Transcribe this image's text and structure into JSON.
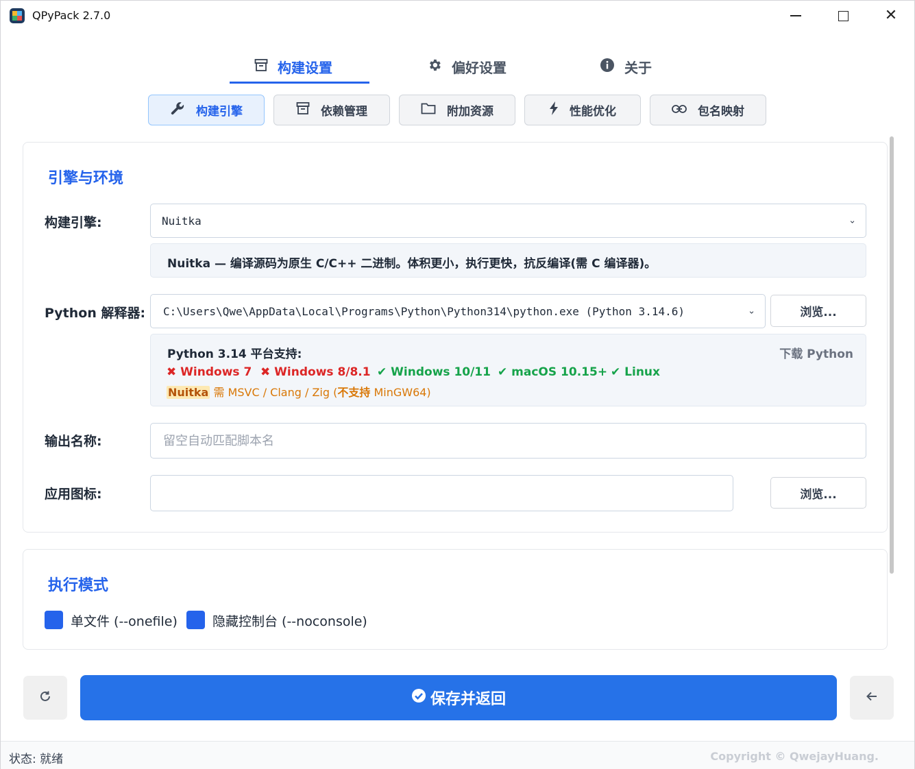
{
  "window": {
    "title": "QPyPack 2.7.0",
    "minimize_glyph": "—",
    "close_glyph": "✕"
  },
  "top_tabs": [
    {
      "label": "构建设置",
      "icon": "archive-icon",
      "active": true
    },
    {
      "label": "偏好设置",
      "icon": "gear-icon",
      "active": false
    },
    {
      "label": "关于",
      "icon": "info-icon",
      "active": false
    }
  ],
  "sub_tabs": [
    {
      "label": "构建引擎",
      "icon": "wrench-icon",
      "active": true
    },
    {
      "label": "依赖管理",
      "icon": "archive-icon",
      "active": false
    },
    {
      "label": "附加资源",
      "icon": "folder-icon",
      "active": false
    },
    {
      "label": "性能优化",
      "icon": "bolt-icon",
      "active": false
    },
    {
      "label": "包名映射",
      "icon": "link-icon",
      "active": false
    }
  ],
  "engine_section": {
    "title": "引擎与环境",
    "engine_label": "构建引擎:",
    "engine_value": "Nuitka",
    "engine_desc": "Nuitka — 编译源码为原生 C/C++ 二进制。体积更小，执行更快，抗反编译(需 C 编译器)。",
    "interpreter_label": "Python 解释器:",
    "interpreter_value": "C:\\Users\\Qwe\\AppData\\Local\\Programs\\Python\\Python314\\python.exe (Python 3.14.6)",
    "browse_label": "浏览...",
    "platform_title": "Python 3.14 平台支持:",
    "download_label": "下载 Python",
    "platforms": [
      {
        "mark": "✖",
        "name": "Windows 7",
        "supported": false
      },
      {
        "mark": "✖",
        "name": "Windows 8/8.1",
        "supported": false
      },
      {
        "mark": "✔",
        "name": "Windows 10/11",
        "supported": true
      },
      {
        "mark": "✔",
        "name": "macOS 10.15+",
        "supported": true
      },
      {
        "mark": "✔",
        "name": "Linux",
        "supported": true
      }
    ],
    "compiler_tag": "Nuitka",
    "compiler_note": " 需 MSVC / Clang / Zig (",
    "compiler_note_bold": "不支持",
    "compiler_note_end": " MinGW64)",
    "output_label": "输出名称:",
    "output_placeholder": "留空自动匹配脚本名",
    "output_value": "",
    "icon_label": "应用图标:",
    "icon_value": "",
    "icon_browse_label": "浏览..."
  },
  "mode_section": {
    "title": "执行模式",
    "options": [
      {
        "label": "单文件 (--onefile)",
        "checked": true
      },
      {
        "label": "隐藏控制台 (--noconsole)",
        "checked": true
      }
    ]
  },
  "actions": {
    "refresh_icon": "refresh-icon",
    "save_label": "保存并返回",
    "save_icon": "check-circle-icon",
    "back_icon": "arrow-left-icon"
  },
  "status": {
    "text": "状态: 就绪",
    "copyright": "Copyright © QwejayHuang."
  },
  "colors": {
    "accent": "#2563eb",
    "primary_button": "#2672e8",
    "unsupported": "#dc2626",
    "supported": "#16a34a",
    "warning": "#d97706"
  }
}
